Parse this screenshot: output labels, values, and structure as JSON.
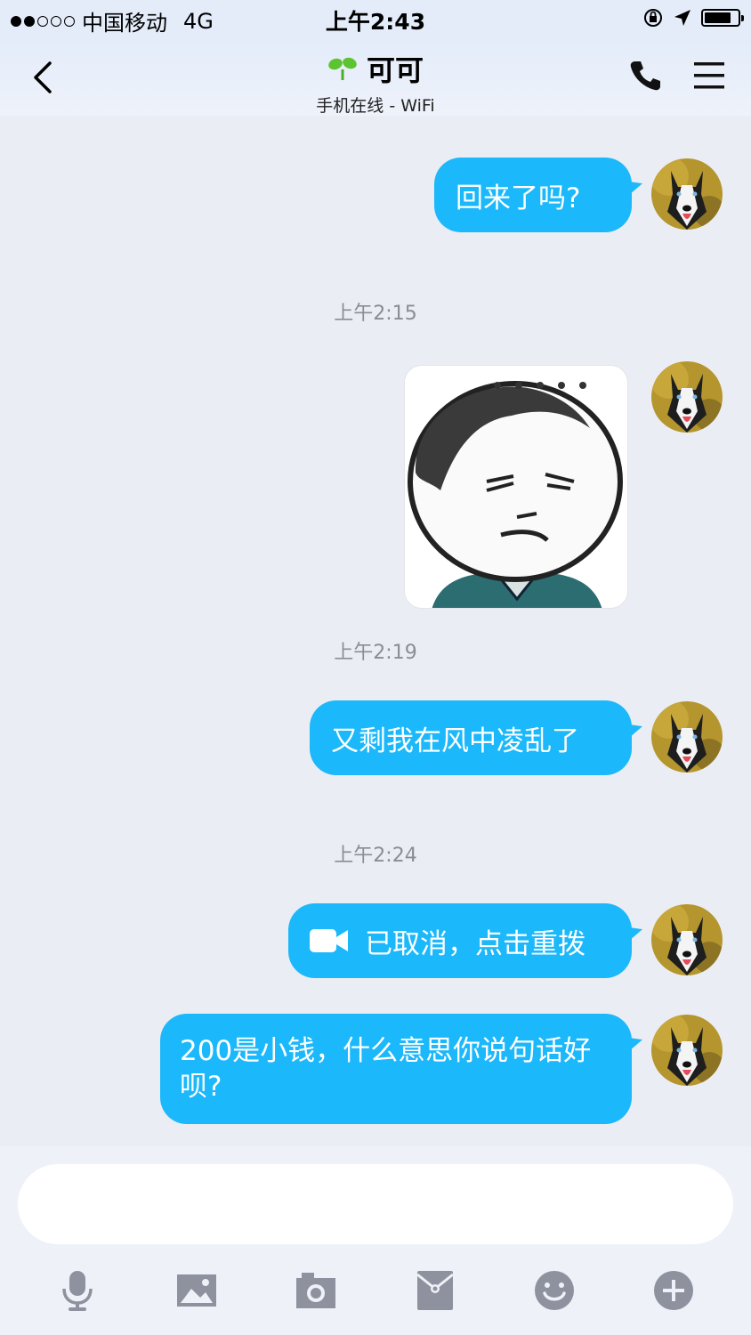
{
  "status_bar": {
    "carrier": "中国移动",
    "network": "4G",
    "time": "上午2:43"
  },
  "header": {
    "title": "可可",
    "subtitle": "手机在线 - WiFi"
  },
  "messages": [
    {
      "type": "text",
      "text": "回来了吗?"
    },
    {
      "type": "timestamp",
      "text": "上午2:15"
    },
    {
      "type": "image",
      "alt": "sticker"
    },
    {
      "type": "timestamp",
      "text": "上午2:19"
    },
    {
      "type": "text",
      "text": "又剩我在风中凌乱了"
    },
    {
      "type": "timestamp",
      "text": "上午2:24"
    },
    {
      "type": "video-call",
      "text": "已取消，点击重拨"
    },
    {
      "type": "text",
      "text": "200是小钱，什么意思你说句话好呗?"
    }
  ],
  "toolbar": {
    "icons": [
      "microphone-icon",
      "image-icon",
      "camera-icon",
      "red-packet-icon",
      "emoji-icon",
      "plus-icon"
    ]
  },
  "colors": {
    "bubble": "#1bb8fb",
    "background": "#ebedf4",
    "icon_gray": "#8e929e"
  }
}
